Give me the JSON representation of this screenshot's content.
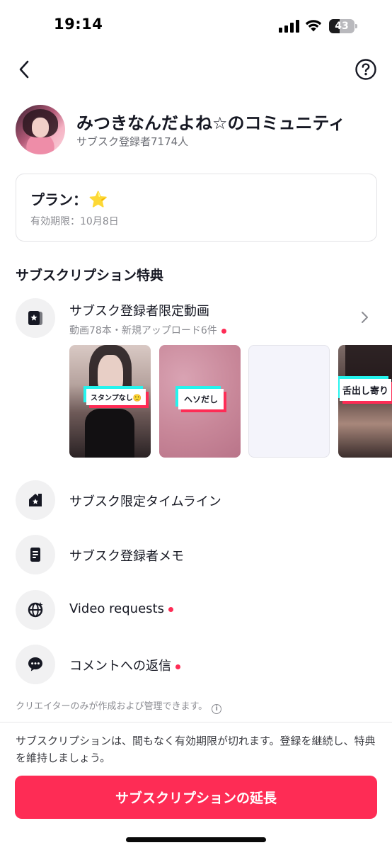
{
  "status_bar": {
    "time": "19:14",
    "battery": "43",
    "battery_level": 0.43
  },
  "community": {
    "name": "みつきなんだよね☆のコミュニティ",
    "subscribers": "サブスク登録者7174人"
  },
  "plan": {
    "title": "プラン：",
    "star": "⭐",
    "expiry": "有効期限：10月8日"
  },
  "section_title": "サブスクリプション特典",
  "benefits": {
    "videos": {
      "label": "サブスク登録者限定動画",
      "sub": "動画78本・新規アップロード6件",
      "thumbnails": [
        {
          "tag": "スタンプなし🙂",
          "icon": "thumbnail-photo"
        },
        {
          "tag": "ヘソだし",
          "icon": "thumbnail-photo"
        },
        {
          "tag": "",
          "icon": "thumbnail-blank"
        },
        {
          "tag": "舌出し寄り",
          "icon": "thumbnail-photo"
        }
      ]
    },
    "timeline": {
      "label": "サブスク限定タイムライン",
      "icon": "home-star-icon"
    },
    "memo": {
      "label": "サブスク登録者メモ",
      "icon": "note-icon"
    },
    "video_requests": {
      "label": "Video requests",
      "icon": "globe-sparkle-icon"
    },
    "comment_replies": {
      "label": "コメントへの返信",
      "icon": "chat-bubble-icon"
    }
  },
  "footer_note": "クリエイターのみが作成および管理できます。",
  "notice": "サブスクリプションは、間もなく有効期限が切れます。登録を継続し、特典を維持しましょう。",
  "cta": "サブスクリプションの延長",
  "colors": {
    "accent": "#fe2c55",
    "teal": "#25f4ee",
    "text": "#161823",
    "muted": "#8a8b91"
  }
}
